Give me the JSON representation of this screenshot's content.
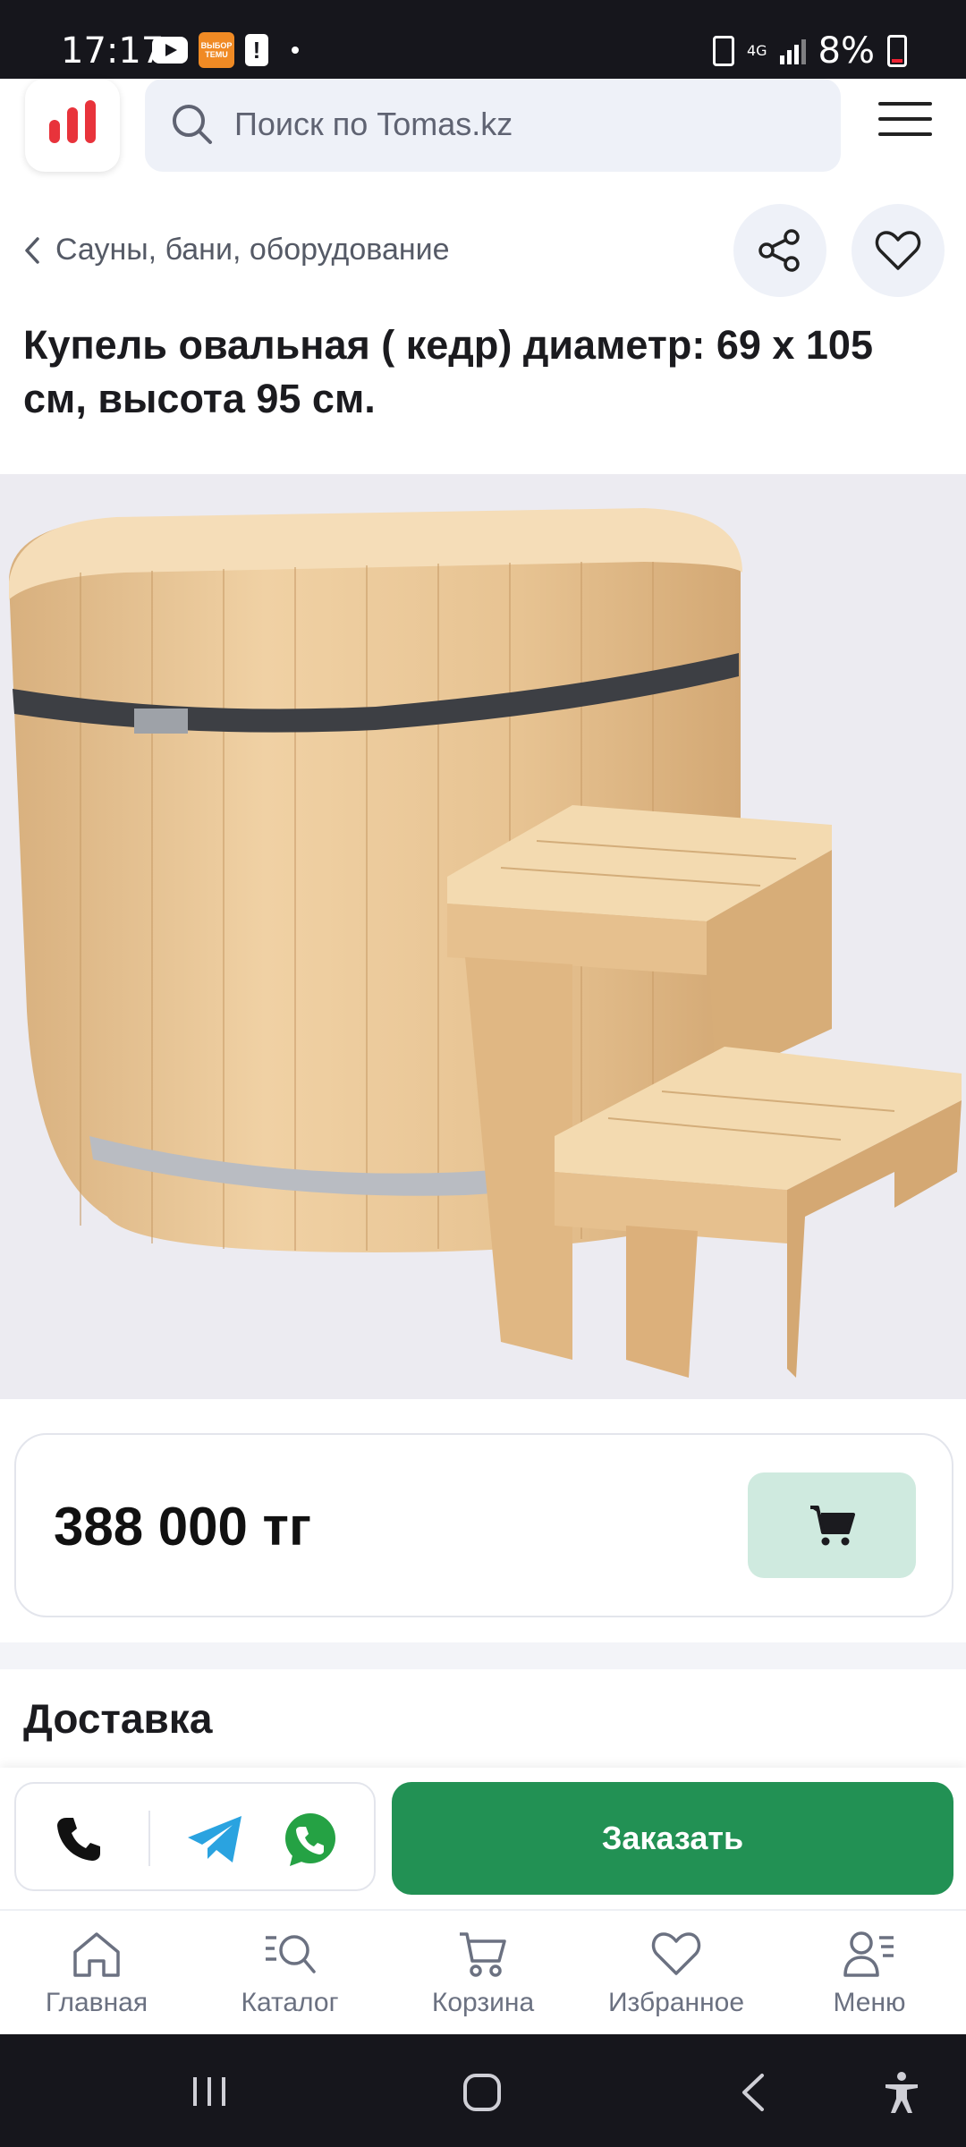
{
  "status_bar": {
    "time": "17:17",
    "temu_label": "ВЫБОР TEMU",
    "network": "4G",
    "battery": "8%"
  },
  "header": {
    "search_placeholder": "Поиск по Tomas.kz",
    "icons": [
      "logo-bars-icon",
      "search-icon",
      "hamburger-menu-icon"
    ]
  },
  "breadcrumb": {
    "back_icon": "chevron-left-icon",
    "label": "Сауны, бани, оборудование"
  },
  "product": {
    "title": "Купель овальная ( кедр)  диаметр: 69 х 105 см, высота 95 см.",
    "price": "388 000 тг",
    "image": "wooden-oval-tub-with-steps"
  },
  "delivery": {
    "title": "Доставка"
  },
  "order_bar": {
    "order_label": "Заказать",
    "icons": [
      "phone-icon",
      "telegram-icon",
      "whatsapp-icon"
    ]
  },
  "bottom_nav": {
    "items": [
      {
        "label": "Главная",
        "icon": "home-icon"
      },
      {
        "label": "Каталог",
        "icon": "catalog-search-icon"
      },
      {
        "label": "Корзина",
        "icon": "cart-icon"
      },
      {
        "label": "Избранное",
        "icon": "heart-icon"
      },
      {
        "label": "Меню",
        "icon": "profile-menu-icon"
      }
    ]
  },
  "colors": {
    "brand_red": "#e8333b",
    "order_green": "#229154",
    "cart_bg": "#cfeadf",
    "search_bg": "#eef1f8"
  }
}
